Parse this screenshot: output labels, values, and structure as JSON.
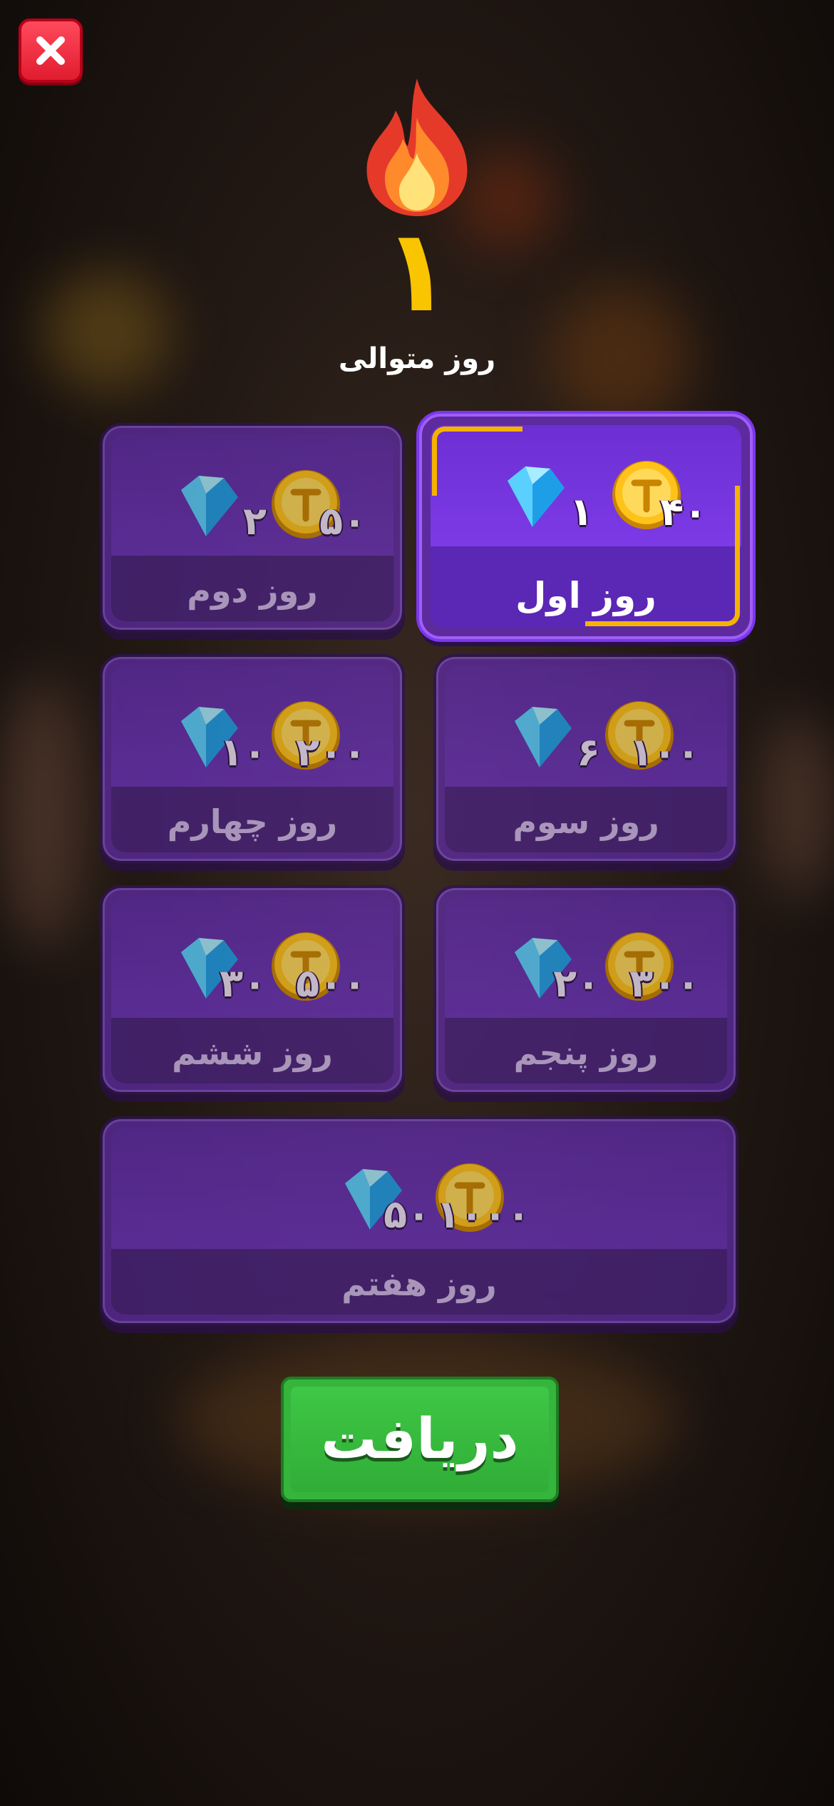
{
  "header": {
    "close_label": "close",
    "streak_count": "۱",
    "streak_label": "روز متوالی"
  },
  "days": [
    {
      "label": "روز اول",
      "coins": "۴۰",
      "gems": "۱",
      "active": true
    },
    {
      "label": "روز دوم",
      "coins": "۵۰",
      "gems": "۲",
      "active": false
    },
    {
      "label": "روز سوم",
      "coins": "۱۰۰",
      "gems": "۶",
      "active": false
    },
    {
      "label": "روز چهارم",
      "coins": "۲۰۰",
      "gems": "۱۰",
      "active": false
    },
    {
      "label": "روز پنجم",
      "coins": "۳۰۰",
      "gems": "۲۰",
      "active": false
    },
    {
      "label": "روز ششم",
      "coins": "۵۰۰",
      "gems": "۳۰",
      "active": false
    },
    {
      "label": "روز هفتم",
      "coins": "۱۰۰۰",
      "gems": "۵۰",
      "active": false
    }
  ],
  "claim_button": "دریافت",
  "icons": {
    "close": "close-icon",
    "flame": "flame-icon",
    "coin": "coin-icon",
    "gem": "gem-icon"
  },
  "colors": {
    "accent": "#f9c400",
    "card": "#5d2b9e",
    "button": "#35b53c",
    "close": "#e11c2f"
  }
}
